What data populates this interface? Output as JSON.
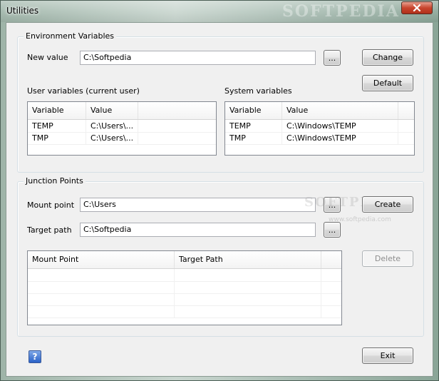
{
  "window": {
    "title": "Utilities",
    "watermark": "SOFTPEDIA"
  },
  "env": {
    "group_label": "Environment Variables",
    "new_value_label": "New value",
    "new_value": "C:\\Softpedia",
    "browse_label": "...",
    "change_label": "Change",
    "default_label": "Default",
    "user_vars_label": "User variables (current user)",
    "system_vars_label": "System variables",
    "user_table": {
      "headers": [
        "Variable",
        "Value"
      ],
      "rows": [
        [
          "TEMP",
          "C:\\Users\\..."
        ],
        [
          "TMP",
          "C:\\Users\\..."
        ]
      ]
    },
    "system_table": {
      "headers": [
        "Variable",
        "Value"
      ],
      "rows": [
        [
          "TEMP",
          "C:\\Windows\\TEMP"
        ],
        [
          "TMP",
          "C:\\Windows\\TEMP"
        ]
      ]
    }
  },
  "junction": {
    "group_label": "Junction Points",
    "mount_label": "Mount point",
    "mount_value": "C:\\Users",
    "target_label": "Target path",
    "target_value": "C:\\Softpedia",
    "browse_label": "...",
    "create_label": "Create",
    "delete_label": "Delete",
    "table_headers": [
      "Mount Point",
      "Target Path"
    ],
    "watermark": "SOFTPEDIA",
    "watermark_url": "www.softpedia.com"
  },
  "footer": {
    "help_label": "?",
    "exit_label": "Exit"
  },
  "colors": {
    "close_button": "#c8452e",
    "help_button": "#2a62c8"
  }
}
